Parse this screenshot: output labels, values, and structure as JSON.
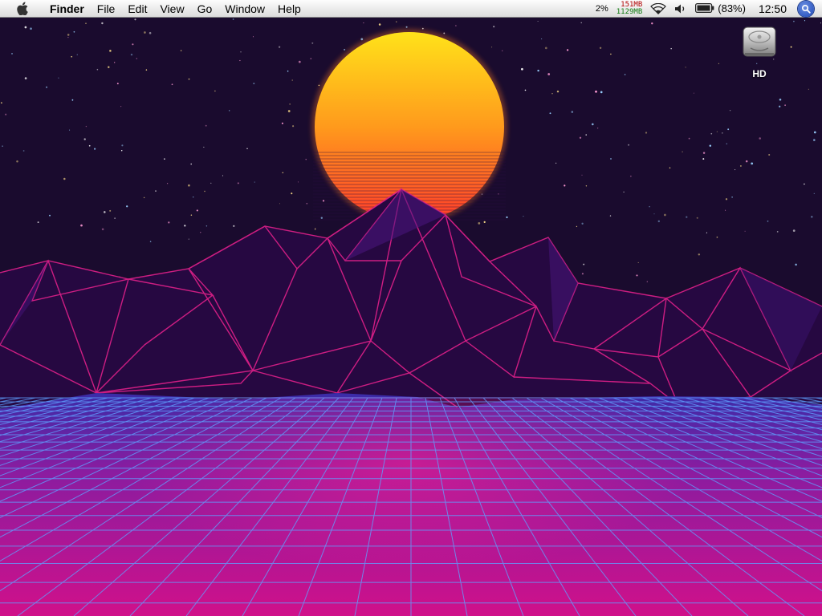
{
  "menubar": {
    "app_name": "Finder",
    "menus": [
      "File",
      "Edit",
      "View",
      "Go",
      "Window",
      "Help"
    ],
    "status": {
      "cpu": "2%",
      "mem_used": "151MB",
      "mem_free": "1129MB",
      "battery": "(83%)",
      "time": "12:50"
    }
  },
  "desktop": {
    "icons": [
      {
        "label": "HD",
        "icon": "hard-drive-icon"
      }
    ]
  },
  "colors": {
    "sky": "#1a0b2e",
    "sun_top": "#ffe21a",
    "sun_bottom": "#ff3d2a",
    "mountain": "#2a0a45",
    "mountain_line": "#e0208a",
    "grid_line": "#5fa0ff",
    "floor_magenta": "#d0108a"
  }
}
